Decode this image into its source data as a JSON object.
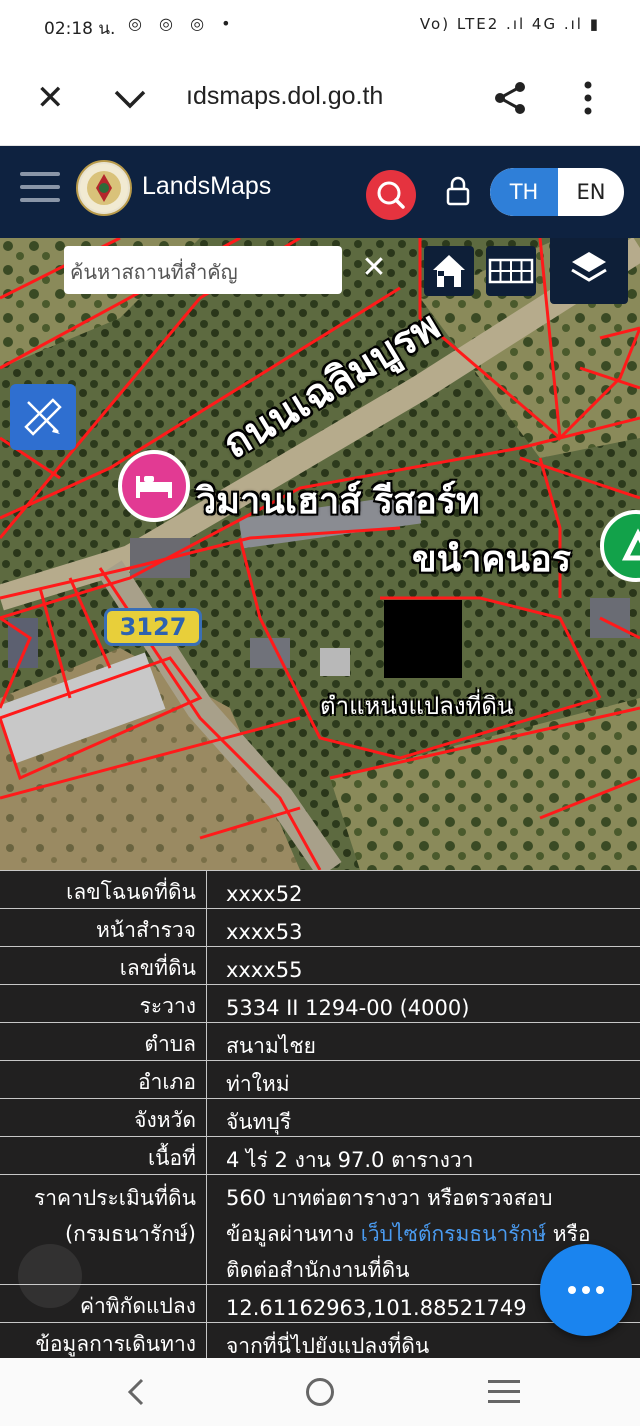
{
  "status_bar": {
    "time": "02:18 น.",
    "notification_icons": "◎ ◎ ◎ •",
    "system": "Vo) LTE2 .ıl 4G .ıl ▮"
  },
  "browser": {
    "url": "ıdsmaps.dol.go.th"
  },
  "app_header": {
    "brand": "LandsMaps",
    "lang_th": "TH",
    "lang_en": "EN",
    "active_lang": "TH",
    "accent": "#2f7fd8",
    "search_color": "#e5333f"
  },
  "map": {
    "search_placeholder": "ค้นหาสถานที่สำคัญ",
    "road_label": "ถนนเฉลิมบูรพ",
    "resort_label": "วิมานเฮาส์ รีสอร์ท",
    "place_label": "ขนำคนอร",
    "route_number": "3127",
    "parcel_position_label": "ตำแหน่งแปลงที่ดิน"
  },
  "info_table": {
    "rows": [
      {
        "label": "เลขโฉนดที่ดิน",
        "value": "xxxx52"
      },
      {
        "label": "หน้าสำรวจ",
        "value": "xxxx53"
      },
      {
        "label": "เลขที่ดิน",
        "value": "xxxx55"
      },
      {
        "label": "ระวาง",
        "value": "5334 II 1294-00 (4000)"
      },
      {
        "label": "ตำบล",
        "value": "สนามไชย"
      },
      {
        "label": "อำเภอ",
        "value": "ท่าใหม่"
      },
      {
        "label": "จังหวัด",
        "value": "จันทบุรี"
      },
      {
        "label": "เนื้อที่",
        "value": "4 ไร่ 2 งาน 97.0 ตารางวา"
      }
    ],
    "price": {
      "label_line1": "ราคาประเมินที่ดิน",
      "label_line2": "(กรมธนารักษ์)",
      "value_line1": "560 บาทต่อตารางวา หรือตรวจสอบ",
      "value_line2_prefix": "ข้อมูลผ่านทาง ",
      "value_line2_link": "เว็บไซต์กรมธนารักษ์",
      "value_line2_suffix": " หรือ",
      "value_line3": "ติดต่อสำนักงานที่ดิน"
    },
    "coords": {
      "label": "ค่าพิกัดแปลง",
      "value": "12.61162963,101.88521749"
    },
    "directions": {
      "label": "ข้อมูลการเดินทาง",
      "value": "จากที่นี่ไปยังแปลงที่ดิน"
    }
  }
}
